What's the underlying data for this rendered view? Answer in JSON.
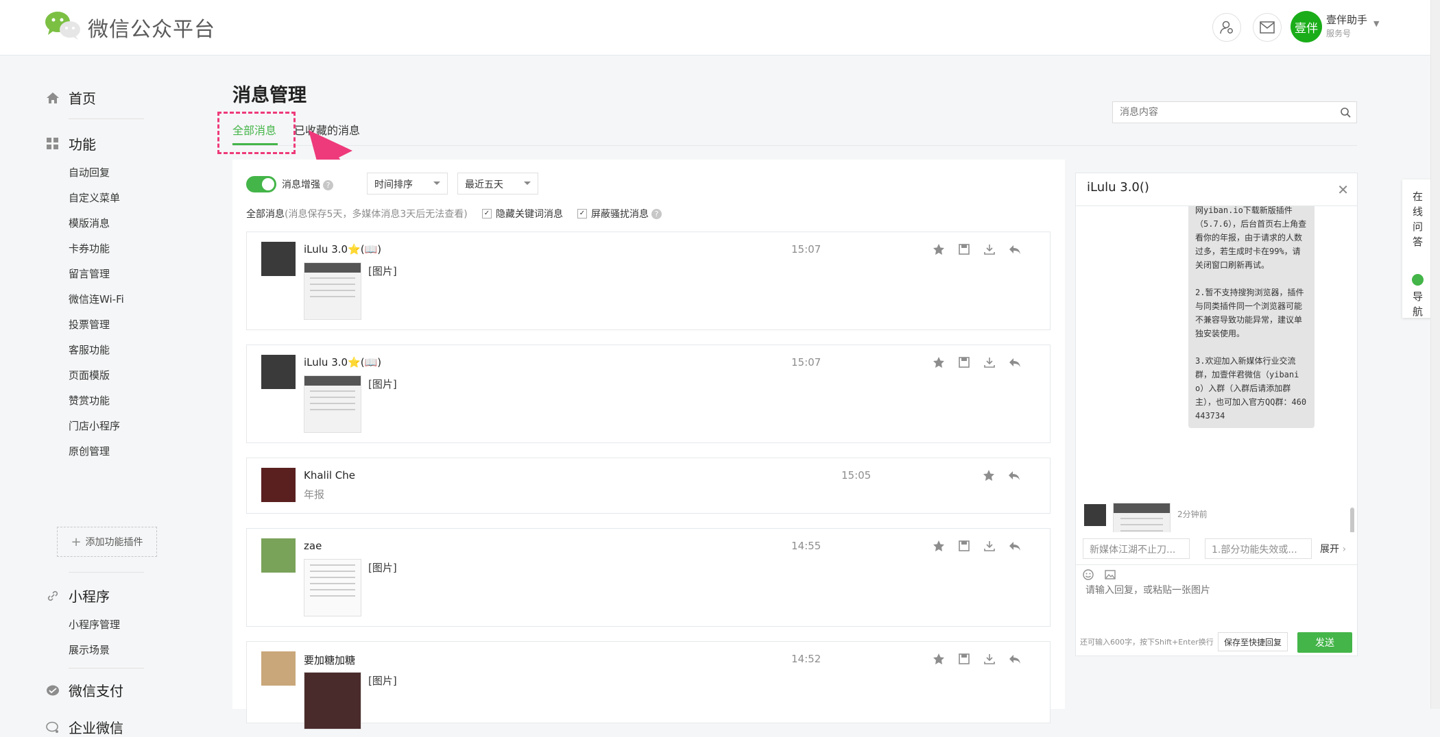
{
  "header": {
    "brand": "微信公众平台",
    "account_avatar_text": "壹伴",
    "account_name": "壹伴助手",
    "account_type": "服务号"
  },
  "sidebar": {
    "home": "首页",
    "functions": "功能",
    "function_items": [
      "自动回复",
      "自定义菜单",
      "模版消息",
      "卡券功能",
      "留言管理",
      "微信连Wi-Fi",
      "投票管理",
      "客服功能",
      "页面模版",
      "赞赏功能",
      "门店小程序",
      "原创管理"
    ],
    "add_plugin": "添加功能插件",
    "miniprogram": "小程序",
    "miniprogram_items": [
      "小程序管理",
      "展示场景"
    ],
    "wechat_pay": "微信支付",
    "wework": "企业微信"
  },
  "main": {
    "title": "消息管理",
    "tabs": [
      {
        "label": "全部消息",
        "active": true
      },
      {
        "label": "已收藏的消息",
        "active": false
      }
    ],
    "search_placeholder": "消息内容",
    "enhance_label": "消息增强",
    "enhance_on": true,
    "sort_select": "时间排序",
    "range_select": "最近五天",
    "note_main": "全部消息",
    "note_detail": "(消息保存5天，多媒体消息3天后无法查看)",
    "hide_keyword": "隐藏关键词消息",
    "block_spam": "屏蔽骚扰消息",
    "messages": [
      {
        "name": "iLulu 3.0⭐(📖)",
        "time": "15:07",
        "tag": "[图片]",
        "type": "image"
      },
      {
        "name": "iLulu 3.0⭐(📖)",
        "time": "15:07",
        "tag": "[图片]",
        "type": "image"
      },
      {
        "name": "Khalil Che",
        "time": "15:05",
        "sub": "年报",
        "type": "text"
      },
      {
        "name": "zae",
        "time": "14:55",
        "tag": "[图片]",
        "type": "image"
      },
      {
        "name": "要加糖加糖",
        "time": "14:52",
        "tag": "[图片]",
        "type": "image"
      }
    ]
  },
  "chat": {
    "title": "iLulu 3.0()",
    "bubble_text": "网yiban.io下载新版插件（5.7.6），后台首页右上角查看你的年报，由于请求的人数过多，若生成时卡在99%，请关闭窗口刷新再试。\n\n2.暂不支持搜狗浏览器，插件与同类插件同一个浏览器可能不兼容导致功能异常，建议单独安装使用。\n\n3.欢迎加入新媒体行业交流群，加壹伴君微信（yibanio）入群（入群后请添加群主），也可加入官方QQ群：460443734",
    "timestamp": "2分钟前",
    "quick_replies": [
      "新媒体江湖不止刀...",
      "1.部分功能失效或..."
    ],
    "expand": "展开",
    "input_placeholder": "请输入回复，或粘贴一张图片",
    "count_hint": "还可输入600字，按下Shift+Enter换行",
    "save_quick": "保存至快捷回复",
    "send": "发送"
  },
  "float_panel": {
    "online_qa": "在线问答",
    "navigate": "导航"
  },
  "colors": {
    "accent": "#44b549",
    "highlight": "#ee3a7a"
  }
}
